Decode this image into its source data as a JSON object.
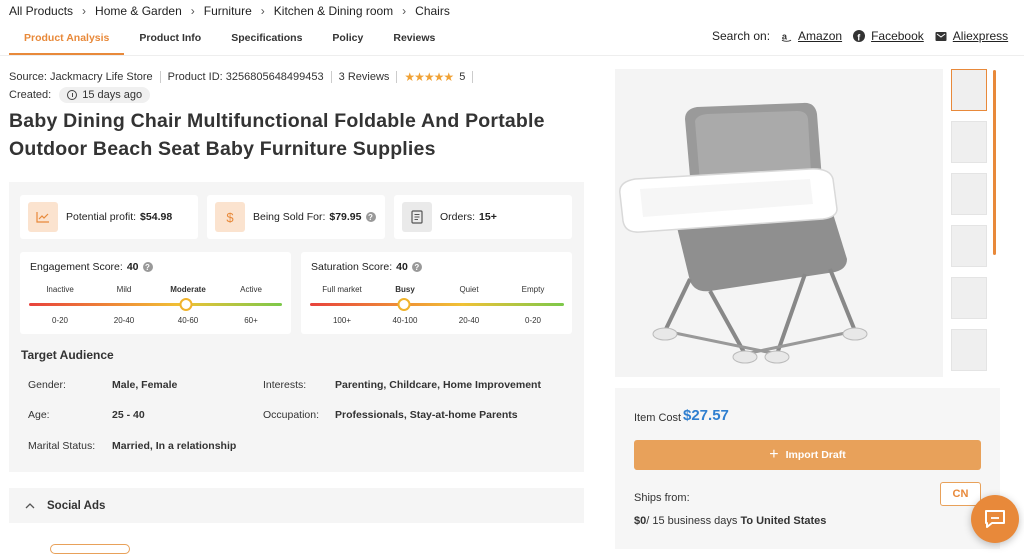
{
  "breadcrumb": [
    "All Products",
    "Home & Garden",
    "Furniture",
    "Kitchen & Dining room",
    "Chairs"
  ],
  "tabs": [
    {
      "label": "Product Analysis",
      "active": true
    },
    {
      "label": "Product Info",
      "active": false
    },
    {
      "label": "Specifications",
      "active": false
    },
    {
      "label": "Policy",
      "active": false
    },
    {
      "label": "Reviews",
      "active": false
    }
  ],
  "search_on": {
    "label": "Search on:",
    "links": [
      {
        "label": "Amazon",
        "icon": "amazon-icon"
      },
      {
        "label": "Facebook",
        "icon": "facebook-icon"
      },
      {
        "label": "Aliexpress",
        "icon": "aliexpress-icon"
      }
    ]
  },
  "meta": {
    "source": "Source: Jackmacry Life Store",
    "product_id": "Product ID: 3256805648499453",
    "reviews": "3 Reviews",
    "rating": 5,
    "rating_text": "5",
    "created_label": "Created:",
    "created_value": "15 days ago"
  },
  "product_title": "Baby Dining Chair Multifunctional Foldable And Portable Outdoor Beach Seat Baby Furniture Supplies",
  "stats": {
    "profit_label": "Potential profit:",
    "profit_value": "$54.98",
    "sold_label": "Being Sold For:",
    "sold_value": "$79.95",
    "orders_label": "Orders:",
    "orders_value": "15+"
  },
  "engagement": {
    "label": "Engagement Score:",
    "value": "40",
    "levels": [
      "Inactive",
      "Mild",
      "Moderate",
      "Active"
    ],
    "ranges": [
      "0-20",
      "20-40",
      "40-60",
      "60+"
    ],
    "highlight_index": 2,
    "knob_fraction": 0.62
  },
  "saturation": {
    "label": "Saturation Score:",
    "value": "40",
    "levels": [
      "Full market",
      "Busy",
      "Quiet",
      "Empty"
    ],
    "ranges": [
      "100+",
      "40-100",
      "20-40",
      "0-20"
    ],
    "highlight_index": 1,
    "knob_fraction": 0.37
  },
  "audience": {
    "title": "Target Audience",
    "gender_label": "Gender:",
    "gender_value": "Male, Female",
    "age_label": "Age:",
    "age_value": "25 - 40",
    "marital_label": "Marital Status:",
    "marital_value": "Married, In a relationship",
    "interests_label": "Interests:",
    "interests_value": "Parenting, Childcare, Home Improvement",
    "occupation_label": "Occupation:",
    "occupation_value": "Professionals, Stay-at-home Parents"
  },
  "social_ads": {
    "label": "Social Ads"
  },
  "pricing": {
    "item_cost_label": "Item Cost",
    "item_cost_value": "$27.57",
    "import_label": "Import Draft",
    "ships_from_label": "Ships from:",
    "ships_from_value": "CN",
    "shipping_cost": "$0",
    "shipping_days": "/ 15 business days",
    "shipping_dest": "To United States"
  },
  "colors": {
    "accent": "#e8893a",
    "price_blue": "#2f7fd0",
    "panel_bg": "#f5f5f5"
  }
}
